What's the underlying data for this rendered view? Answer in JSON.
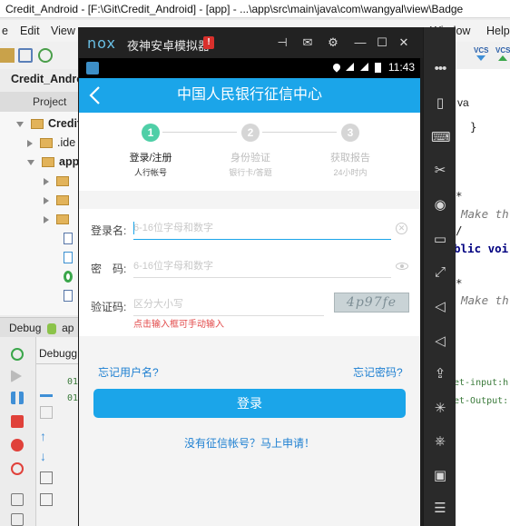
{
  "ide": {
    "window_title": "Credit_Android - [F:\\Git\\Credit_Android] - [app] - ...\\app\\src\\main\\java\\com\\wangyal\\view\\Badge",
    "menu": {
      "file": "e",
      "edit": "Edit",
      "view": "View",
      "window": "Window",
      "help": "Help"
    },
    "vcs_label_1": "VCS",
    "vcs_label_2": "VCS",
    "breadcrumb": "Credit_Andro",
    "project_tab": "Project",
    "tree": [
      {
        "label": "Credit"
      },
      {
        "label": ".ide"
      },
      {
        "label": "app"
      },
      {
        "label": ""
      },
      {
        "label": ""
      },
      {
        "label": ""
      }
    ],
    "debug_tab": "Debug",
    "debug_app": "ap",
    "debugger_tab": "Debugg",
    "debug_line_1": "01",
    "debug_line_2": "01",
    "code_tab_fragment": "va",
    "code": {
      "brace": "}",
      "asterisk1": "*",
      "make_th_1": "Make th",
      "slash": "/",
      "public_voi": "blic voi",
      "asterisk2": "*",
      "make_th_2": "Make th",
      "set_input": "et-input:h",
      "set_output": "et-Output:"
    }
  },
  "nox": {
    "logo": "nox",
    "title": "夜神安卓模拟器",
    "alert": "!",
    "time": "11:43"
  },
  "app": {
    "header_title": "中国人民银行征信中心",
    "back_icon": "chevron-left-icon",
    "steps": [
      {
        "num": "1",
        "title": "登录/注册",
        "sub": "人行帐号"
      },
      {
        "num": "2",
        "title": "身份验证",
        "sub": "银行卡/答题"
      },
      {
        "num": "3",
        "title": "获取报告",
        "sub": "24小时内"
      }
    ],
    "username_label": "登录名:",
    "username_placeholder": "6-16位字母和数字",
    "password_label": "密　码:",
    "password_placeholder": "6-16位字母和数字",
    "captcha_label": "验证码:",
    "captcha_placeholder": "区分大小写",
    "captcha_text": "4p97fe",
    "captcha_hint": "点击输入框可手动输入",
    "forgot_username": "忘记用户名?",
    "forgot_password": "忘记密码?",
    "login_button": "登录",
    "register_link": "没有征信帐号？马上申请！"
  },
  "colors": {
    "accent": "#1ba5e9",
    "step_active": "#4fcfa7",
    "step_inactive": "#d6d6d6",
    "hint_red": "#e24949",
    "link_blue": "#1d7fd1"
  }
}
